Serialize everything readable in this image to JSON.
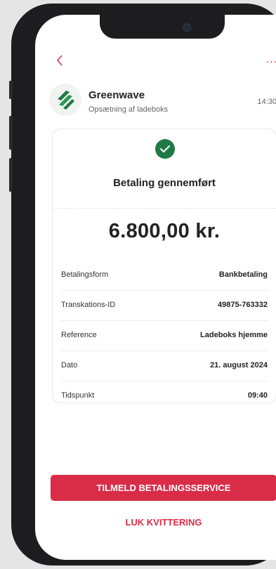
{
  "nav": {
    "back_icon": "chevron-left-icon",
    "more_label": "...",
    "accent": "#e0243c"
  },
  "header": {
    "company": "Greenwave",
    "subtitle": "Opsætning af ladeboks",
    "time": "14:30",
    "logo_icon": "greenwave-logo-icon"
  },
  "receipt": {
    "status": "Betaling gennemført",
    "status_icon": "check-circle-icon",
    "status_color": "#1f7a45",
    "amount": "6.800,00 kr.",
    "rows": [
      {
        "label": "Betalingsform",
        "value": "Bankbetaling"
      },
      {
        "label": "Transkations-ID",
        "value": "49875-763332"
      },
      {
        "label": "Reference",
        "value": "Ladeboks hjemme"
      },
      {
        "label": "Dato",
        "value": "21. august 2024"
      },
      {
        "label": "Tidspunkt",
        "value": "09:40"
      }
    ]
  },
  "actions": {
    "primary": "TILMELD BETALINGSSERVICE",
    "secondary": "LUK KVITTERING",
    "primary_color": "#d92c47"
  }
}
